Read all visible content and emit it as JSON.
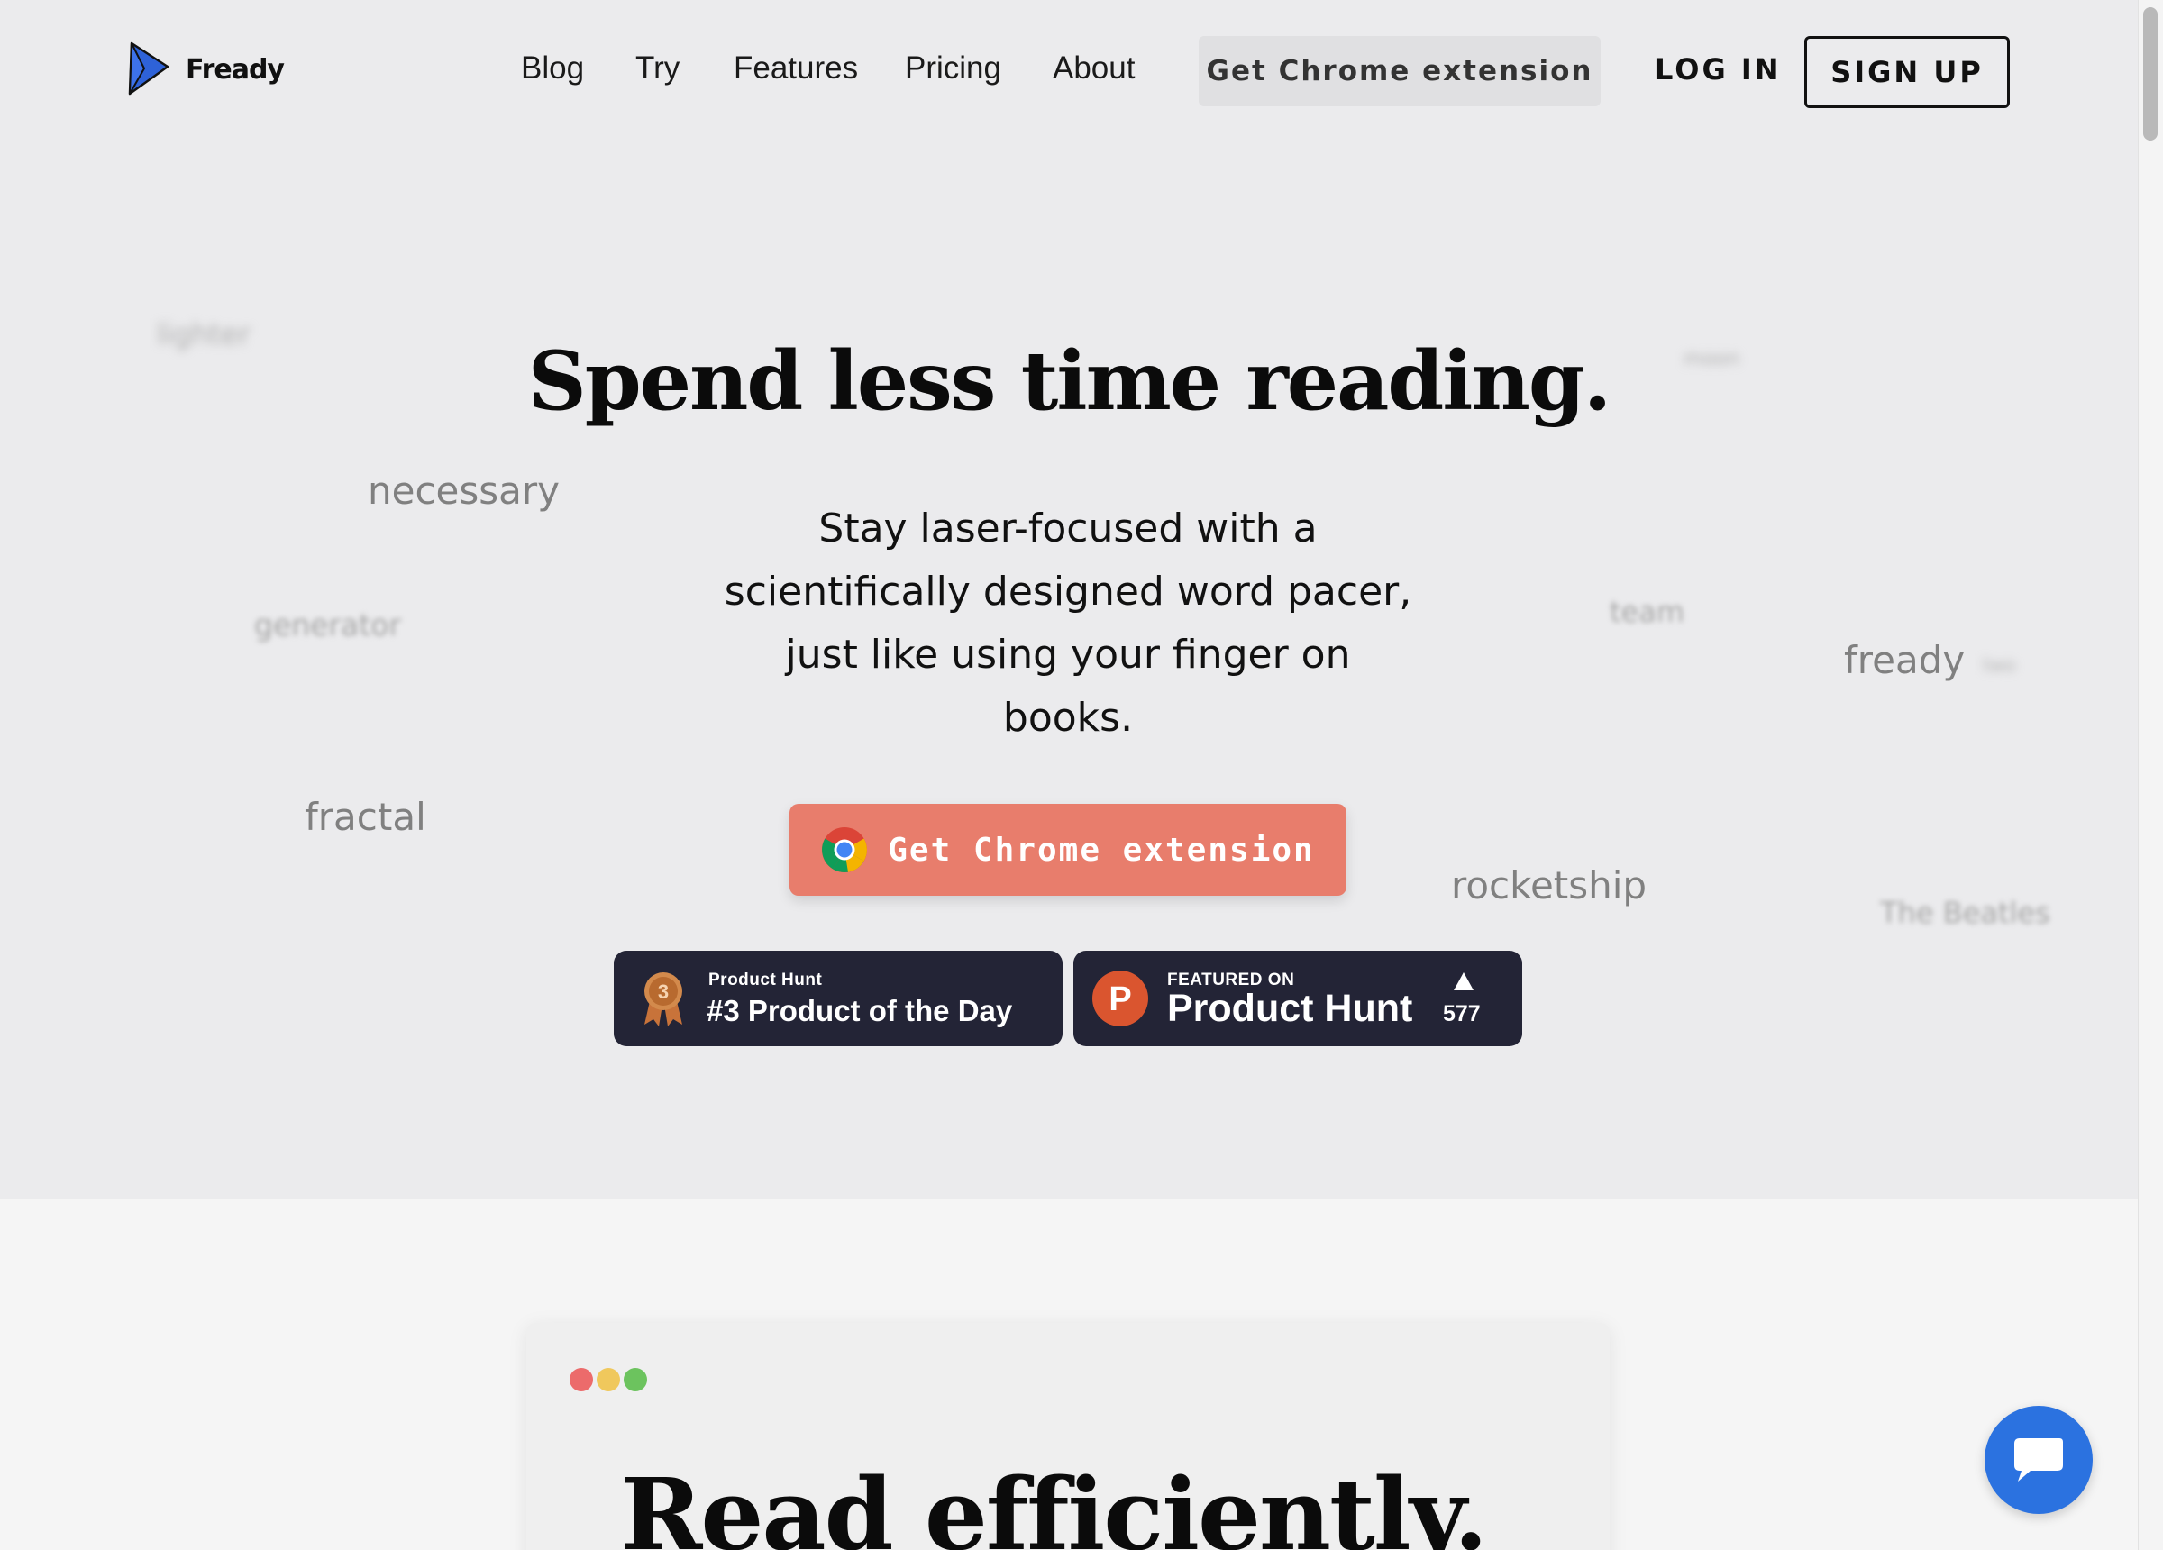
{
  "header": {
    "logo_text": "Fready",
    "nav": [
      "Blog",
      "Try",
      "Features",
      "Pricing",
      "About"
    ],
    "chrome_button": "Get Chrome extension",
    "login": "LOG IN",
    "signup": "SIGN UP"
  },
  "hero": {
    "headline": "Spend less time reading.",
    "subhead": "Stay laser-focused with a scientifically designed word pacer, just like using your finger on books.",
    "cta": "Get Chrome extension",
    "floating_words": [
      "lighter",
      "moon",
      "necessary",
      "generator",
      "team",
      "fready",
      "two",
      "fractal",
      "rocketship",
      "The Beatles"
    ],
    "badges": {
      "award": {
        "label": "Product Hunt",
        "title": "#3 Product of the Day",
        "rank": "3"
      },
      "featured": {
        "label": "FEATURED ON",
        "title": "Product Hunt",
        "upvotes": "577",
        "letter": "P"
      }
    }
  },
  "preview": {
    "title": "Read efficiently."
  },
  "colors": {
    "accent": "#e87d6c",
    "badge_bg": "#232436",
    "chat": "#2b72e0",
    "ph_orange": "#da552f"
  },
  "icons": {
    "logo": "play-triangle-logo-icon",
    "cta": "chrome-icon",
    "award": "medal-icon",
    "upvote": "triangle-up-icon",
    "chat": "chat-bubble-icon"
  }
}
